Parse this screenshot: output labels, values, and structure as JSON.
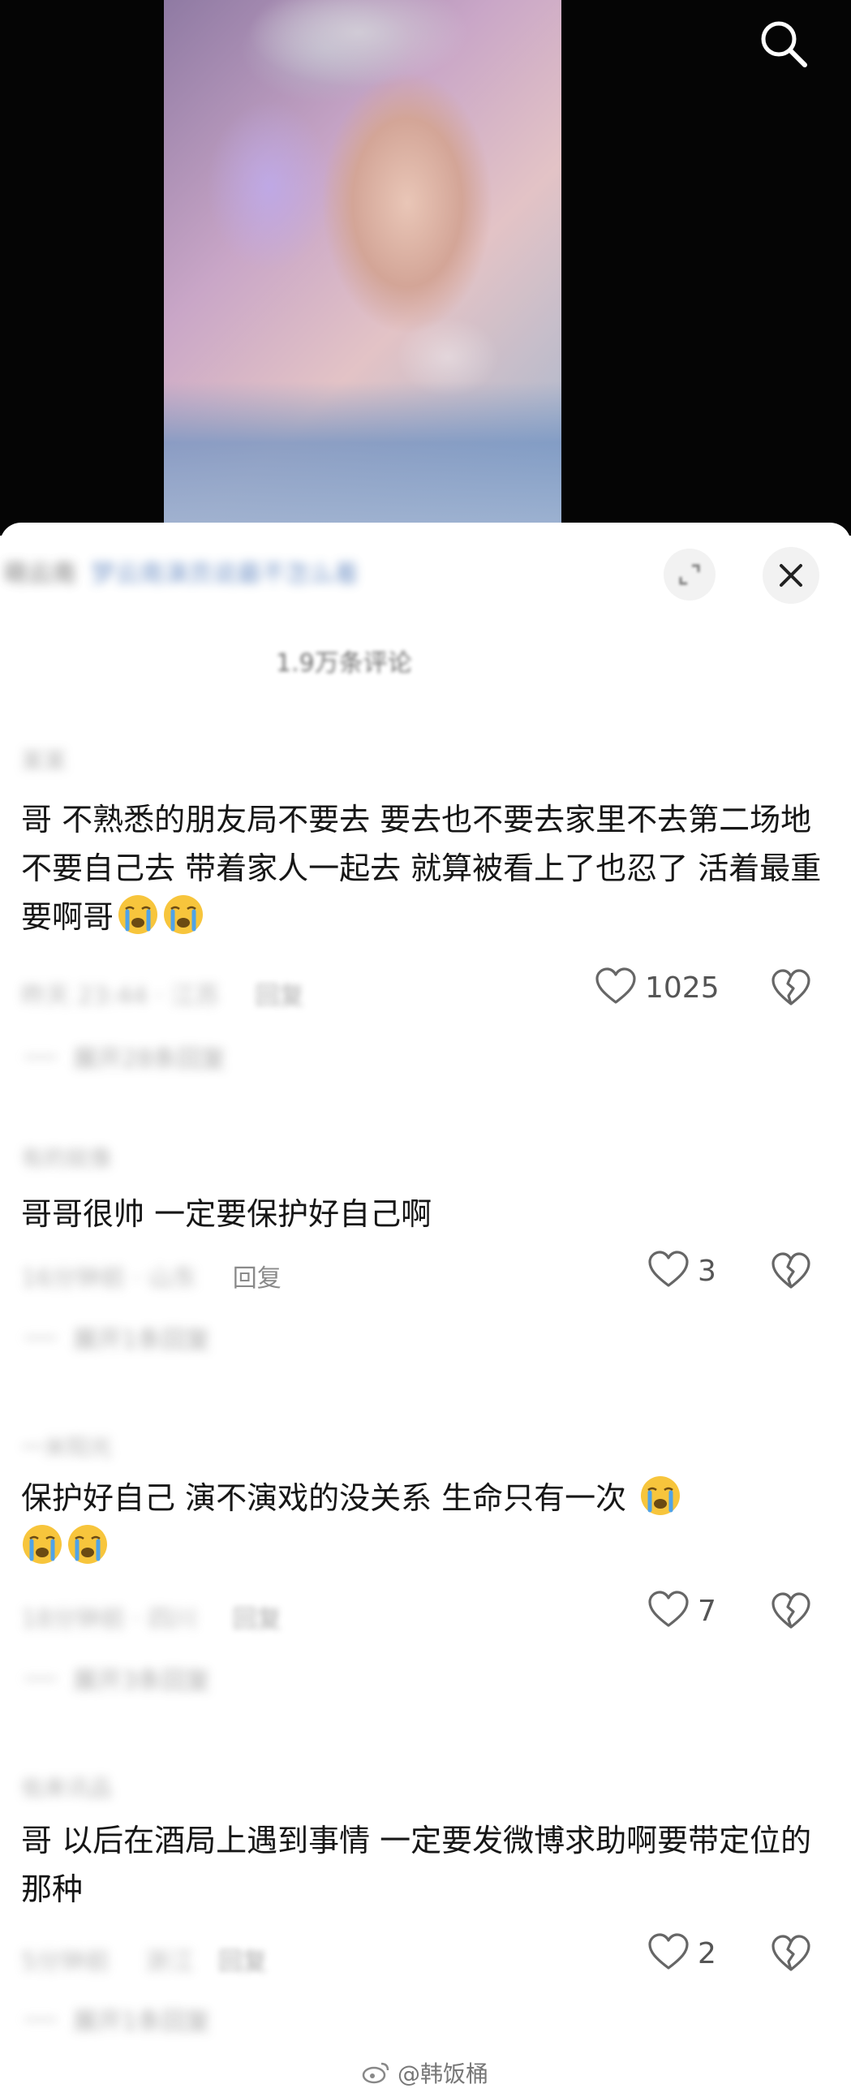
{
  "header": {
    "author_blurred": "萌云南",
    "title_blurred": "梦云南演员说最不怎么着",
    "comment_count": "1.9万条评论"
  },
  "comments": [
    {
      "user": "某某",
      "text": "哥 不熟悉的朋友局不要去 要去也不要去家里不去第二场地 不要自己去 带着家人一起去 就算被看上了也忍了 活着最重要啊哥",
      "emojis": 2,
      "time": "昨天 23:44 · 江苏",
      "reply": "回复",
      "likes": "1025",
      "more": "展开28条回复"
    },
    {
      "user": "有的就像",
      "text": "哥哥很帅  一定要保护好自己啊",
      "emojis": 0,
      "time": "16分钟前 · 山东",
      "reply": "回复",
      "likes": "3",
      "more": "展开1条回复"
    },
    {
      "user": "一米阳光",
      "text": "保护好自己 演不演戏的没关系 生命只有一次",
      "emojis": 3,
      "time": "18分钟前 · 四川",
      "reply": "回复",
      "likes": "7",
      "more": "展开3条回复"
    },
    {
      "user": "佑来讯品",
      "text": "哥 以后在酒局上遇到事情 一定要发微博求助啊要带定位的那种",
      "emojis": 0,
      "time": "5分钟前",
      "region": "浙江",
      "reply": "回复",
      "likes": "2",
      "more": "展开1条回复"
    }
  ],
  "watermark": "@韩饭桶",
  "colors": {
    "emoji_face": "#f7c53c",
    "emoji_tears": "#4fa3e8",
    "text": "#161616",
    "meta": "#8a8a8a"
  },
  "icons": [
    "search-icon",
    "expand-icon",
    "close-icon",
    "heart-icon",
    "broken-heart-icon",
    "crying-emoji",
    "weibo-logo"
  ]
}
